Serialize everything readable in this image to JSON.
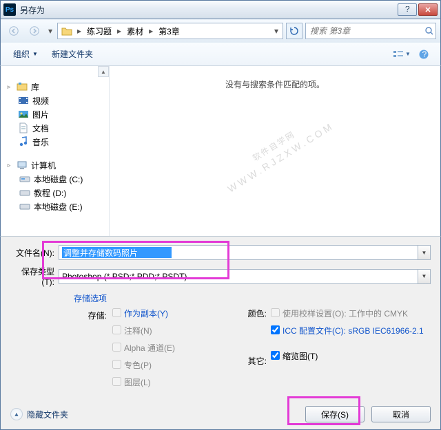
{
  "window": {
    "title": "另存为"
  },
  "nav": {
    "crumbs": [
      "练习题",
      "素材",
      "第3章"
    ],
    "search_placeholder": "搜索 第3章"
  },
  "toolbar": {
    "organize": "组织",
    "new_folder": "新建文件夹"
  },
  "tree": {
    "library": "库",
    "videos": "视频",
    "pictures": "图片",
    "documents": "文档",
    "music": "音乐",
    "computer": "计算机",
    "disk_c": "本地磁盘 (C:)",
    "disk_d": "教程 (D:)",
    "disk_e": "本地磁盘 (E:)"
  },
  "content": {
    "empty": "没有与搜索条件匹配的项。"
  },
  "watermark": {
    "line1": "软件自学网",
    "line2": "WWW.RJZXW.COM"
  },
  "fields": {
    "filename_label": "文件名(N):",
    "filename_value": "调整并存储数码照片",
    "filetype_label": "保存类型(T):",
    "filetype_value": "Photoshop (*.PSD;*.PDD;*.PSDT)"
  },
  "options": {
    "store_options": "存储选项",
    "store_label": "存储:",
    "as_copy": "作为副本(Y)",
    "notes": "注释(N)",
    "alpha": "Alpha 通道(E)",
    "spot": "专色(P)",
    "layers": "图层(L)",
    "color_label": "颜色:",
    "use_proof": "使用校样设置(O): 工作中的 CMYK",
    "icc_profile": "ICC 配置文件(C): sRGB IEC61966-2.1",
    "other_label": "其它:",
    "thumbnail": "缩览图(T)"
  },
  "footer": {
    "hide_folders": "隐藏文件夹",
    "save": "保存(S)",
    "cancel": "取消"
  }
}
